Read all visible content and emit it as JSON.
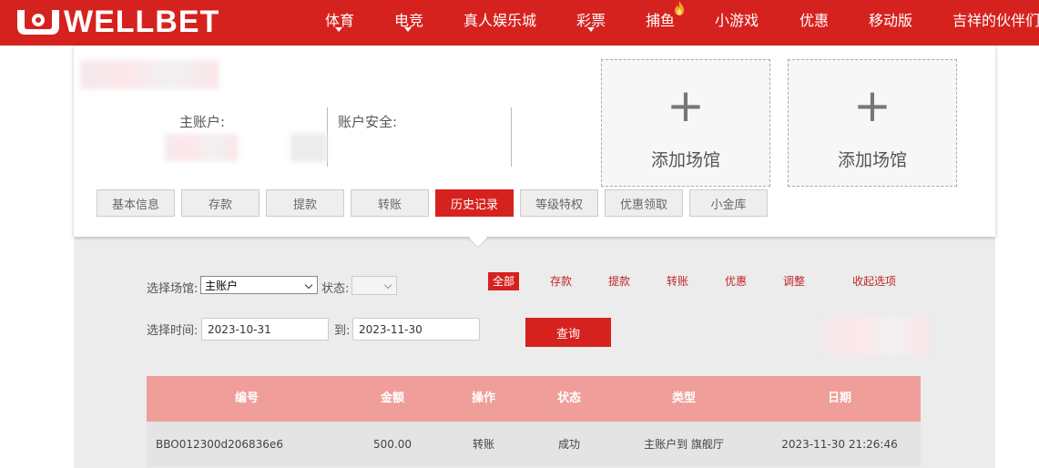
{
  "brand": {
    "logo_text": "WELLBET"
  },
  "nav": {
    "items": [
      {
        "label": "体育",
        "caret": true
      },
      {
        "label": "电竞",
        "caret": true
      },
      {
        "label": "真人娱乐城",
        "caret": false
      },
      {
        "label": "彩票",
        "caret": true
      },
      {
        "label": "捕鱼",
        "caret": false
      },
      {
        "label": "小游戏",
        "caret": false
      },
      {
        "label": "优惠",
        "caret": false
      },
      {
        "label": "移动版",
        "caret": false
      },
      {
        "label": "吉祥的伙伴们",
        "caret": false
      }
    ]
  },
  "account": {
    "main_label": "主账户:",
    "security_label": "账户安全:",
    "add_venue_1": "添加场馆",
    "add_venue_2": "添加场馆",
    "add_symbol": "+"
  },
  "tabs": [
    "基本信息",
    "存款",
    "提款",
    "转账",
    "历史记录",
    "等级特权",
    "优惠领取",
    "小金库"
  ],
  "active_tab": "历史记录",
  "filters": {
    "venue_label": "选择场馆:",
    "venue_value": "主账户",
    "status_label": "状态:",
    "time_label": "选择时间:",
    "date_from": "2023-10-31",
    "to_label": "到:",
    "date_to": "2023-11-30",
    "query_label": "查询",
    "categories": [
      "全部",
      "存款",
      "提款",
      "转账",
      "优惠",
      "调整",
      "收起选项"
    ],
    "active_category": "全部"
  },
  "table": {
    "headers": [
      "编号",
      "金额",
      "操作",
      "状态",
      "类型",
      "日期"
    ],
    "rows": [
      [
        "BBO012300d206836e6",
        "500.00",
        "转账",
        "成功",
        "主账户到 旗舰厅",
        "2023-11-30 21:26:46"
      ]
    ]
  },
  "colors": {
    "brand_red": "#d6221e",
    "table_header": "#ef9e99",
    "row_bg": "#e4e4e4"
  }
}
